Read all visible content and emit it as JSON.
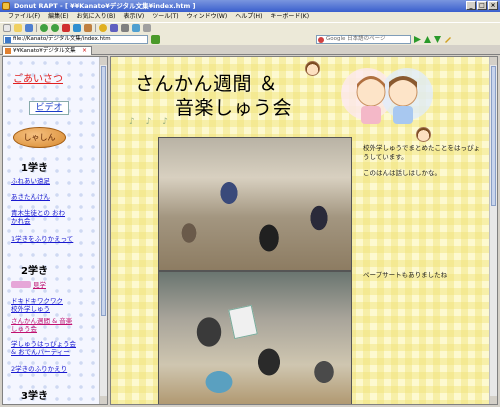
{
  "window": {
    "title": "Donut RAPT - [ ¥¥Kanato¥デジタル文集¥index.htm ]",
    "controls": [
      "_",
      "□",
      "×"
    ]
  },
  "menu": [
    "ファイル(F)",
    "編集(E)",
    "お気に入り(B)",
    "表示(V)",
    "ツール(T)",
    "ウィンドウ(W)",
    "ヘルプ(H)",
    "キーボード(K)"
  ],
  "address": {
    "value": "file://Kanato/デジタル文集/index.htm"
  },
  "search": {
    "placeholder": "Google 日本語のページ"
  },
  "tab": {
    "label": "¥¥Kanato¥デジタル文集¥index.htm"
  },
  "nav": {
    "greeting": "ごあいさつ",
    "video": "ビデオ",
    "photo": "しゃしん",
    "grade1": "1学き",
    "grade1_links": [
      "ふれあい遠足",
      "あさたんけん",
      "青木生徒との おわかれ会",
      "1学きをふりかえって"
    ],
    "grade2": "2学き",
    "grade2_first": "見学",
    "grade2_links": [
      "ドキドキワクワク 校外学しゅう",
      "さんかん週間 & 音楽しゅう会",
      "学しゅうはっぴょう会 & おでんパーティー",
      "2学きのふりかえり"
    ],
    "grade3": "3学き"
  },
  "content": {
    "title_line1": "さんかん週間 ＆",
    "title_line2": "音楽しゅう会",
    "notes": "♪ ♪ ♪",
    "text1": "校外学しゅうでまとめたことをはっぴょうしています。",
    "text2": "このはんは話しはしかな。",
    "text3": "ペープサートもありましたね"
  },
  "colors": {
    "titlebar": "#3a5fcd",
    "greeting": "#e02020",
    "link": "#1a1ad0",
    "content_bg": "#fdf9d0"
  }
}
